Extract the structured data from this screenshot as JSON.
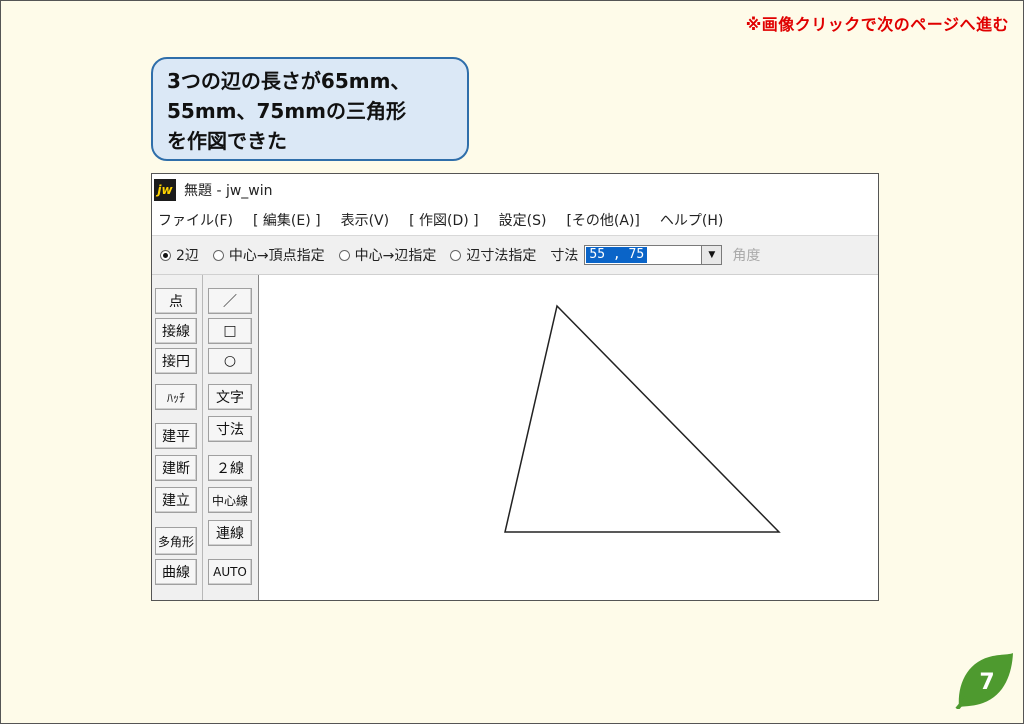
{
  "nav_note": "※画像クリックで次のページへ進む",
  "callout": {
    "lines": [
      "3つの辺の長さが65mm、",
      "55mm、75mmの三角形",
      "を作図できた"
    ]
  },
  "window": {
    "icon_text": "jw",
    "title": "無題 - jw_win",
    "menu": [
      "ファイル(F)",
      "[ 編集(E) ]",
      "表示(V)",
      "[ 作図(D) ]",
      "設定(S)",
      "[その他(A)]",
      "ヘルプ(H)"
    ],
    "toolbar": {
      "radios": [
        {
          "label": "2辺",
          "checked": true
        },
        {
          "label": "中心→頂点指定",
          "checked": false
        },
        {
          "label": "中心→辺指定",
          "checked": false
        },
        {
          "label": "辺寸法指定",
          "checked": false
        }
      ],
      "dimension_label": "寸法",
      "dimension_value": "55 , 75",
      "angle_label": "角度"
    },
    "left_tools": [
      "点",
      "接線",
      "接円",
      "ﾊｯﾁ",
      "建平",
      "建断",
      "建立",
      "多角形",
      "曲線"
    ],
    "right_tools": [
      "／",
      "□",
      "○",
      "文字",
      "寸法",
      "２線",
      "中心線",
      "連線",
      "AUTO"
    ],
    "triangle": {
      "sides_mm": [
        65,
        55,
        75
      ]
    }
  },
  "page_number": "7",
  "colors": {
    "background": "#fefbe9",
    "callout_fill": "#dbe8f6",
    "callout_border": "#2f6eaa",
    "nav_note": "#e00000",
    "leaf": "#4e9a2f",
    "selection": "#0a64c8"
  }
}
